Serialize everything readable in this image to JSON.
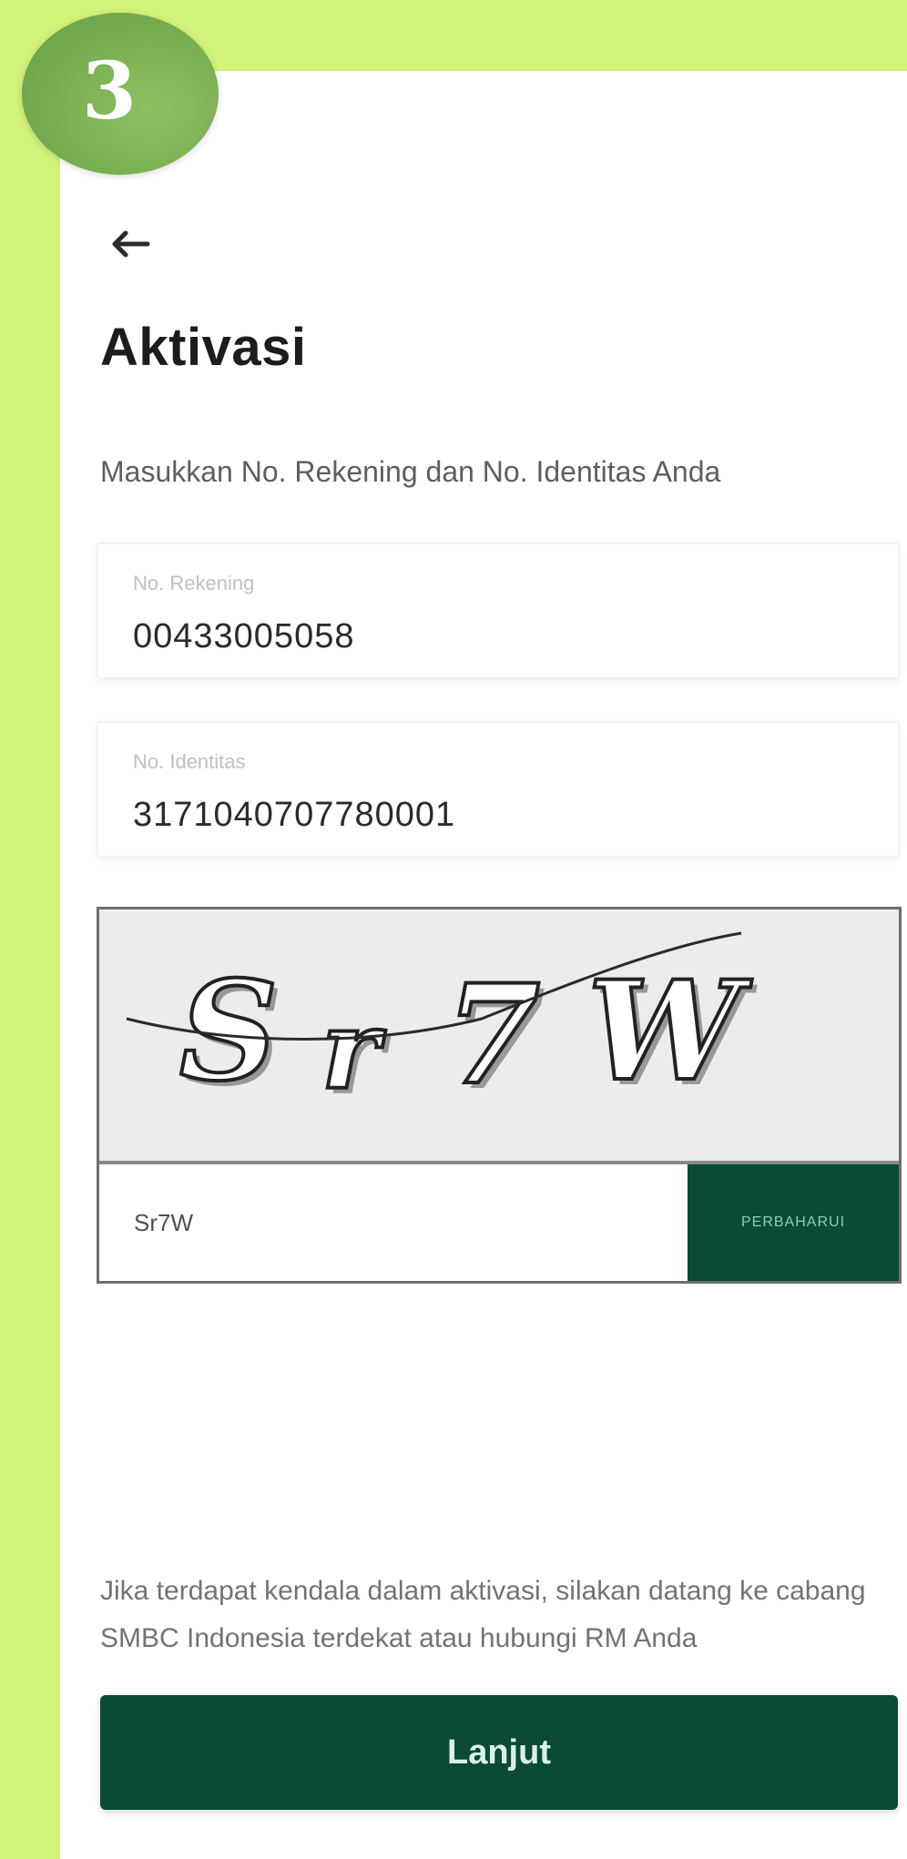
{
  "step": {
    "number": "3"
  },
  "header": {
    "back_icon": "arrow-left-icon",
    "title": "Aktivasi",
    "subtitle": "Masukkan No. Rekening dan No. Identitas Anda"
  },
  "form": {
    "account": {
      "label": "No. Rekening",
      "value": "00433005058"
    },
    "identity": {
      "label": "No. Identitas",
      "value": "3171040707780001"
    },
    "captcha": {
      "image_text": "Sr7W",
      "input_value": "Sr7W",
      "refresh_label": "PERBAHARUI"
    }
  },
  "help_text": "Jika terdapat kendala dalam aktivasi, silakan datang ke cabang SMBC Indonesia terdekat atau hubungi RM Anda",
  "submit_label": "Lanjut",
  "colors": {
    "background": "#d2f27a",
    "primary": "#0b4a36",
    "badge": "#79ad52"
  }
}
